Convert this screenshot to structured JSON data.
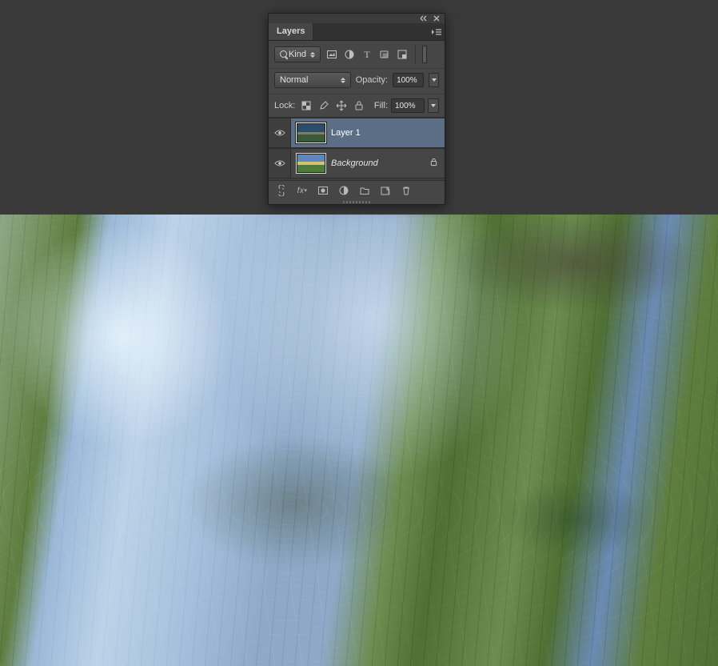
{
  "panel": {
    "tab_title": "Layers",
    "filter": {
      "kind_label": "Kind",
      "icons": [
        "image-filter-icon",
        "adjustment-filter-icon",
        "type-filter-icon",
        "shape-filter-icon",
        "smartobject-filter-icon"
      ]
    },
    "blend_mode": "Normal",
    "opacity_label": "Opacity:",
    "opacity_value": "100%",
    "lock_label": "Lock:",
    "fill_label": "Fill:",
    "fill_value": "100%",
    "layers": [
      {
        "name": "Layer 1",
        "visible": true,
        "selected": true,
        "locked": false,
        "italic": false
      },
      {
        "name": "Background",
        "visible": true,
        "selected": false,
        "locked": true,
        "italic": true
      }
    ],
    "footer_icons": [
      "link-layers-icon",
      "fx-icon",
      "mask-icon",
      "adjustment-layer-icon",
      "group-icon",
      "new-layer-icon",
      "trash-icon"
    ]
  }
}
